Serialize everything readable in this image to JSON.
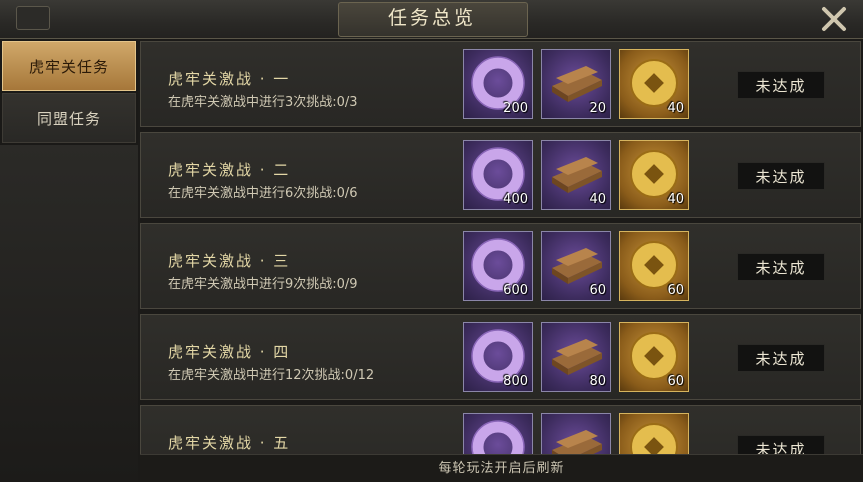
{
  "header": {
    "title": "任务总览"
  },
  "sidebar": {
    "tabs": [
      {
        "label": "虎牢关任务",
        "active": true
      },
      {
        "label": "同盟任务",
        "active": false
      }
    ]
  },
  "tasks": [
    {
      "title": "虎牢关激战 · 一",
      "desc": "在虎牢关激战中进行3次挑战:0/3",
      "rewards": [
        {
          "icon": "jade-ring-icon",
          "qty": "200"
        },
        {
          "icon": "wood-planks-icon",
          "qty": "20"
        },
        {
          "icon": "gold-coin-icon",
          "qty": "40"
        }
      ],
      "status": "未达成"
    },
    {
      "title": "虎牢关激战 · 二",
      "desc": "在虎牢关激战中进行6次挑战:0/6",
      "rewards": [
        {
          "icon": "jade-ring-icon",
          "qty": "400"
        },
        {
          "icon": "wood-planks-icon",
          "qty": "40"
        },
        {
          "icon": "gold-coin-icon",
          "qty": "40"
        }
      ],
      "status": "未达成"
    },
    {
      "title": "虎牢关激战 · 三",
      "desc": "在虎牢关激战中进行9次挑战:0/9",
      "rewards": [
        {
          "icon": "jade-ring-icon",
          "qty": "600"
        },
        {
          "icon": "wood-planks-icon",
          "qty": "60"
        },
        {
          "icon": "gold-coin-icon",
          "qty": "60"
        }
      ],
      "status": "未达成"
    },
    {
      "title": "虎牢关激战 · 四",
      "desc": "在虎牢关激战中进行12次挑战:0/12",
      "rewards": [
        {
          "icon": "jade-ring-icon",
          "qty": "800"
        },
        {
          "icon": "wood-planks-icon",
          "qty": "80"
        },
        {
          "icon": "gold-coin-icon",
          "qty": "60"
        }
      ],
      "status": "未达成"
    },
    {
      "title": "虎牢关激战 · 五",
      "desc": "",
      "rewards": [
        {
          "icon": "jade-ring-icon",
          "qty": ""
        },
        {
          "icon": "wood-planks-icon",
          "qty": ""
        },
        {
          "icon": "gold-coin-icon",
          "qty": ""
        }
      ],
      "status": "未达成"
    }
  ],
  "footer": {
    "note": "每轮玩法开启后刷新"
  }
}
